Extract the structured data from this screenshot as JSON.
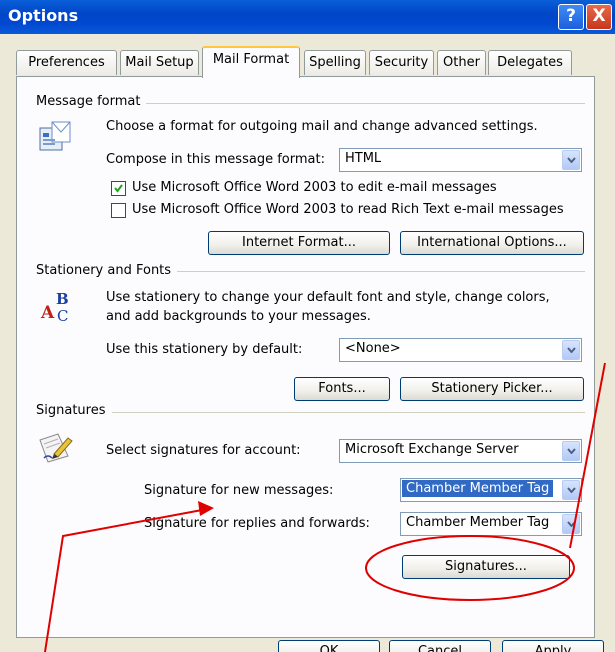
{
  "window": {
    "title": "Options",
    "help_glyph": "?",
    "close_glyph": "X"
  },
  "tabs": [
    "Preferences",
    "Mail Setup",
    "Mail Format",
    "Spelling",
    "Security",
    "Other",
    "Delegates"
  ],
  "message_format": {
    "heading": "Message format",
    "description": "Choose a format for outgoing mail and change advanced settings.",
    "compose_label": "Compose in this message format:",
    "compose_value": "HTML",
    "use_word_edit": {
      "label": "Use Microsoft Office Word 2003 to edit e-mail messages",
      "checked": true
    },
    "use_word_read": {
      "label": "Use Microsoft Office Word 2003 to read Rich Text e-mail messages",
      "checked": false
    },
    "internet_format_button": "Internet Format...",
    "international_options_button": "International Options..."
  },
  "stationery": {
    "heading": "Stationery and Fonts",
    "description_line1": "Use stationery to change your default font and style, change colors,",
    "description_line2": "and add backgrounds to your messages.",
    "use_label": "Use this stationery by default:",
    "use_value": "<None>",
    "fonts_button": "Fonts...",
    "picker_button": "Stationery Picker..."
  },
  "signatures": {
    "heading": "Signatures",
    "account_label": "Select signatures for account:",
    "account_value": "Microsoft Exchange Server",
    "new_label": "Signature for new messages:",
    "new_value": "Chamber Member Tag",
    "reply_label": "Signature for replies and forwards:",
    "reply_value": "Chamber Member Tag",
    "signatures_button": "Signatures..."
  },
  "footer": {
    "ok": "OK",
    "cancel": "Cancel",
    "apply": "Apply"
  },
  "annotation_color": "#e00000"
}
